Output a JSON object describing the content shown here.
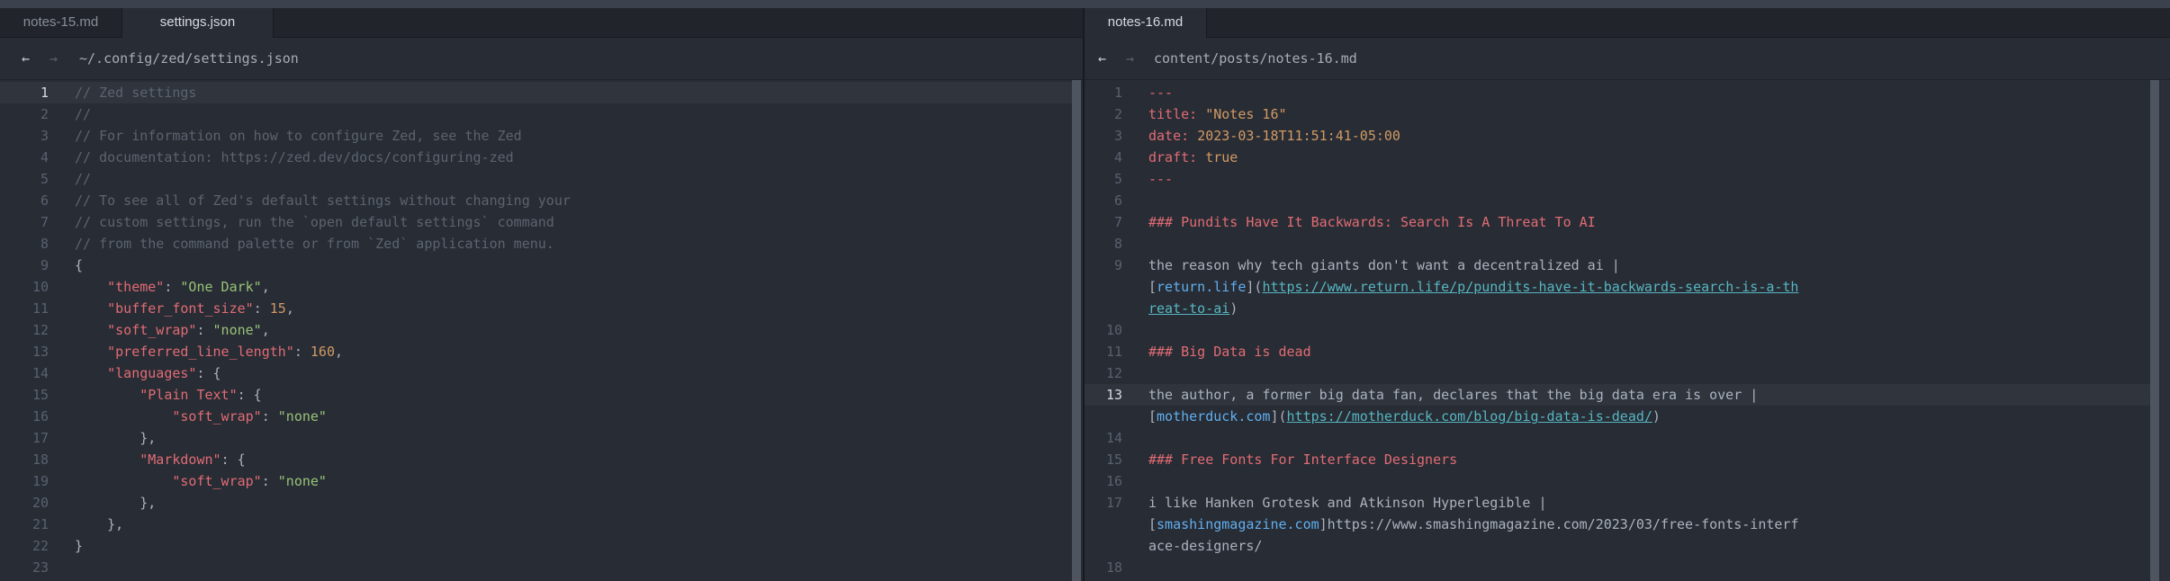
{
  "left_pane": {
    "tabs": [
      {
        "label": "notes-15.md",
        "active": false
      },
      {
        "label": "settings.json",
        "active": true
      }
    ],
    "breadcrumb": "~/.config/zed/settings.json",
    "current_line": 1,
    "lines": [
      {
        "n": "1",
        "segs": [
          {
            "t": "// Zed settings",
            "c": "com"
          }
        ]
      },
      {
        "n": "2",
        "segs": [
          {
            "t": "//",
            "c": "com"
          }
        ]
      },
      {
        "n": "3",
        "segs": [
          {
            "t": "// For information on how to configure Zed, see the Zed",
            "c": "com"
          }
        ]
      },
      {
        "n": "4",
        "segs": [
          {
            "t": "// documentation: https://zed.dev/docs/configuring-zed",
            "c": "com"
          }
        ]
      },
      {
        "n": "5",
        "segs": [
          {
            "t": "//",
            "c": "com"
          }
        ]
      },
      {
        "n": "6",
        "segs": [
          {
            "t": "// To see all of Zed's default settings without changing your",
            "c": "com"
          }
        ]
      },
      {
        "n": "7",
        "segs": [
          {
            "t": "// custom settings, run the `open default settings` command",
            "c": "com"
          }
        ]
      },
      {
        "n": "8",
        "segs": [
          {
            "t": "// from the command palette or from `Zed` application menu.",
            "c": "com"
          }
        ]
      },
      {
        "n": "9",
        "segs": [
          {
            "t": "{",
            "c": "pun"
          }
        ]
      },
      {
        "n": "10",
        "segs": [
          {
            "t": "    ",
            "c": "pun"
          },
          {
            "t": "\"theme\"",
            "c": "key"
          },
          {
            "t": ": ",
            "c": "pun"
          },
          {
            "t": "\"One Dark\"",
            "c": "str"
          },
          {
            "t": ",",
            "c": "pun"
          }
        ]
      },
      {
        "n": "11",
        "segs": [
          {
            "t": "    ",
            "c": "pun"
          },
          {
            "t": "\"buffer_font_size\"",
            "c": "key"
          },
          {
            "t": ": ",
            "c": "pun"
          },
          {
            "t": "15",
            "c": "num"
          },
          {
            "t": ",",
            "c": "pun"
          }
        ]
      },
      {
        "n": "12",
        "segs": [
          {
            "t": "    ",
            "c": "pun"
          },
          {
            "t": "\"soft_wrap\"",
            "c": "key"
          },
          {
            "t": ": ",
            "c": "pun"
          },
          {
            "t": "\"none\"",
            "c": "str"
          },
          {
            "t": ",",
            "c": "pun"
          }
        ]
      },
      {
        "n": "13",
        "segs": [
          {
            "t": "    ",
            "c": "pun"
          },
          {
            "t": "\"preferred_line_length\"",
            "c": "key"
          },
          {
            "t": ": ",
            "c": "pun"
          },
          {
            "t": "160",
            "c": "num"
          },
          {
            "t": ",",
            "c": "pun"
          }
        ]
      },
      {
        "n": "14",
        "segs": [
          {
            "t": "    ",
            "c": "pun"
          },
          {
            "t": "\"languages\"",
            "c": "key"
          },
          {
            "t": ": {",
            "c": "pun"
          }
        ]
      },
      {
        "n": "15",
        "segs": [
          {
            "t": "        ",
            "c": "pun"
          },
          {
            "t": "\"Plain Text\"",
            "c": "key"
          },
          {
            "t": ": {",
            "c": "pun"
          }
        ]
      },
      {
        "n": "16",
        "segs": [
          {
            "t": "            ",
            "c": "pun"
          },
          {
            "t": "\"soft_wrap\"",
            "c": "key"
          },
          {
            "t": ": ",
            "c": "pun"
          },
          {
            "t": "\"none\"",
            "c": "str"
          }
        ]
      },
      {
        "n": "17",
        "segs": [
          {
            "t": "        },",
            "c": "pun"
          }
        ]
      },
      {
        "n": "18",
        "segs": [
          {
            "t": "        ",
            "c": "pun"
          },
          {
            "t": "\"Markdown\"",
            "c": "key"
          },
          {
            "t": ": {",
            "c": "pun"
          }
        ]
      },
      {
        "n": "19",
        "segs": [
          {
            "t": "            ",
            "c": "pun"
          },
          {
            "t": "\"soft_wrap\"",
            "c": "key"
          },
          {
            "t": ": ",
            "c": "pun"
          },
          {
            "t": "\"none\"",
            "c": "str"
          }
        ]
      },
      {
        "n": "20",
        "segs": [
          {
            "t": "        },",
            "c": "pun"
          }
        ]
      },
      {
        "n": "21",
        "segs": [
          {
            "t": "    },",
            "c": "pun"
          }
        ]
      },
      {
        "n": "22",
        "segs": [
          {
            "t": "}",
            "c": "pun"
          }
        ]
      },
      {
        "n": "23",
        "segs": []
      }
    ]
  },
  "right_pane": {
    "tabs": [
      {
        "label": "notes-16.md",
        "active": true
      }
    ],
    "breadcrumb": "content/posts/notes-16.md",
    "current_line": 13,
    "lines": [
      {
        "n": "1",
        "segs": [
          {
            "t": "---",
            "c": "md-key"
          }
        ]
      },
      {
        "n": "2",
        "segs": [
          {
            "t": "title: ",
            "c": "md-key"
          },
          {
            "t": "\"Notes 16\"",
            "c": "md-val"
          }
        ]
      },
      {
        "n": "3",
        "segs": [
          {
            "t": "date: ",
            "c": "md-key"
          },
          {
            "t": "2023-03-18T11:51:41-05:00",
            "c": "md-val"
          }
        ]
      },
      {
        "n": "4",
        "segs": [
          {
            "t": "draft: ",
            "c": "md-key"
          },
          {
            "t": "true",
            "c": "md-val"
          }
        ]
      },
      {
        "n": "5",
        "segs": [
          {
            "t": "---",
            "c": "md-key"
          }
        ]
      },
      {
        "n": "6",
        "segs": []
      },
      {
        "n": "7",
        "segs": [
          {
            "t": "### Pundits Have It Backwards: Search Is A Threat To AI",
            "c": "md-h"
          }
        ]
      },
      {
        "n": "8",
        "segs": []
      },
      {
        "n": "9",
        "segs": [
          {
            "t": "the reason why tech giants don't want a decentralized ai |",
            "c": "md-plain"
          }
        ]
      },
      {
        "n": "",
        "segs": [
          {
            "t": "[",
            "c": "md-plain"
          },
          {
            "t": "return.life",
            "c": "md-link-text"
          },
          {
            "t": "](",
            "c": "md-plain"
          },
          {
            "t": "https://www.return.life/p/pundits-have-it-backwards-search-is-a-th",
            "c": "md-url"
          }
        ]
      },
      {
        "n": "",
        "segs": [
          {
            "t": "reat-to-ai",
            "c": "md-url"
          },
          {
            "t": ")",
            "c": "md-plain"
          }
        ]
      },
      {
        "n": "10",
        "segs": []
      },
      {
        "n": "11",
        "segs": [
          {
            "t": "### Big Data is dead",
            "c": "md-h"
          }
        ]
      },
      {
        "n": "12",
        "segs": []
      },
      {
        "n": "13",
        "segs": [
          {
            "t": "the author, a former big data fan, declares that the big data era is over |",
            "c": "md-plain"
          }
        ]
      },
      {
        "n": "",
        "segs": [
          {
            "t": "[",
            "c": "md-plain"
          },
          {
            "t": "motherduck.com",
            "c": "md-link-text"
          },
          {
            "t": "](",
            "c": "md-plain"
          },
          {
            "t": "https://motherduck.com/blog/big-data-is-dead/",
            "c": "md-url"
          },
          {
            "t": ")",
            "c": "md-plain"
          }
        ]
      },
      {
        "n": "14",
        "segs": []
      },
      {
        "n": "15",
        "segs": [
          {
            "t": "### Free Fonts For Interface Designers",
            "c": "md-h"
          }
        ]
      },
      {
        "n": "16",
        "segs": []
      },
      {
        "n": "17",
        "segs": [
          {
            "t": "i like Hanken Grotesk and Atkinson Hyperlegible |",
            "c": "md-plain"
          }
        ]
      },
      {
        "n": "",
        "segs": [
          {
            "t": "[",
            "c": "md-plain"
          },
          {
            "t": "smashingmagazine.com",
            "c": "md-link-text"
          },
          {
            "t": "]https://www.smashingmagazine.com/2023/03/free-fonts-interf",
            "c": "md-plain"
          }
        ]
      },
      {
        "n": "",
        "segs": [
          {
            "t": "ace-designers/",
            "c": "md-plain"
          }
        ]
      },
      {
        "n": "18",
        "segs": []
      }
    ]
  },
  "icons": {
    "back": "arrow-left-icon",
    "forward": "arrow-right-icon"
  },
  "glyphs": {
    "back": "←",
    "forward": "→"
  },
  "colors": {
    "background": "#282c34",
    "tabbar": "#21252b",
    "comment": "#5c6370",
    "key": "#e06c75",
    "string": "#98c379",
    "number": "#d19a66",
    "link": "#61afef",
    "url": "#56b6c2"
  }
}
